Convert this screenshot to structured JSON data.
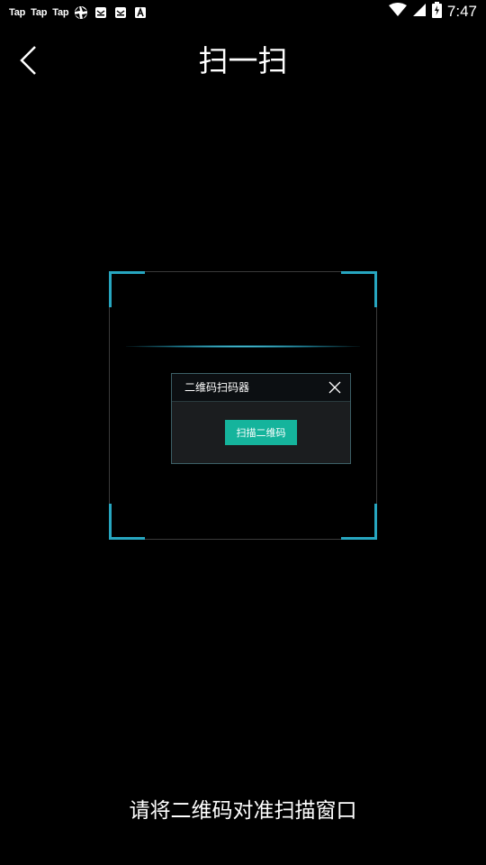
{
  "status_bar": {
    "notifications": [
      "Tap",
      "Tap",
      "Tap"
    ],
    "time": "7:47"
  },
  "header": {
    "title": "扫一扫"
  },
  "dialog": {
    "title": "二维码扫码器",
    "button_label": "扫描二维码"
  },
  "hint": "请将二维码对准扫描窗口",
  "colors": {
    "background": "#000000",
    "frame_corner": "#27a6c0",
    "scan_line": "#5adcf0",
    "primary_button": "#15b49c",
    "dialog_header": "#0c0f12",
    "dialog_body": "#1b1d1f"
  },
  "icons": [
    "tap-icon",
    "aperture-icon",
    "mail-icon",
    "mail-icon",
    "font-icon",
    "wifi-icon",
    "signal-icon",
    "battery-charging-icon",
    "back-arrow-icon",
    "close-icon"
  ]
}
